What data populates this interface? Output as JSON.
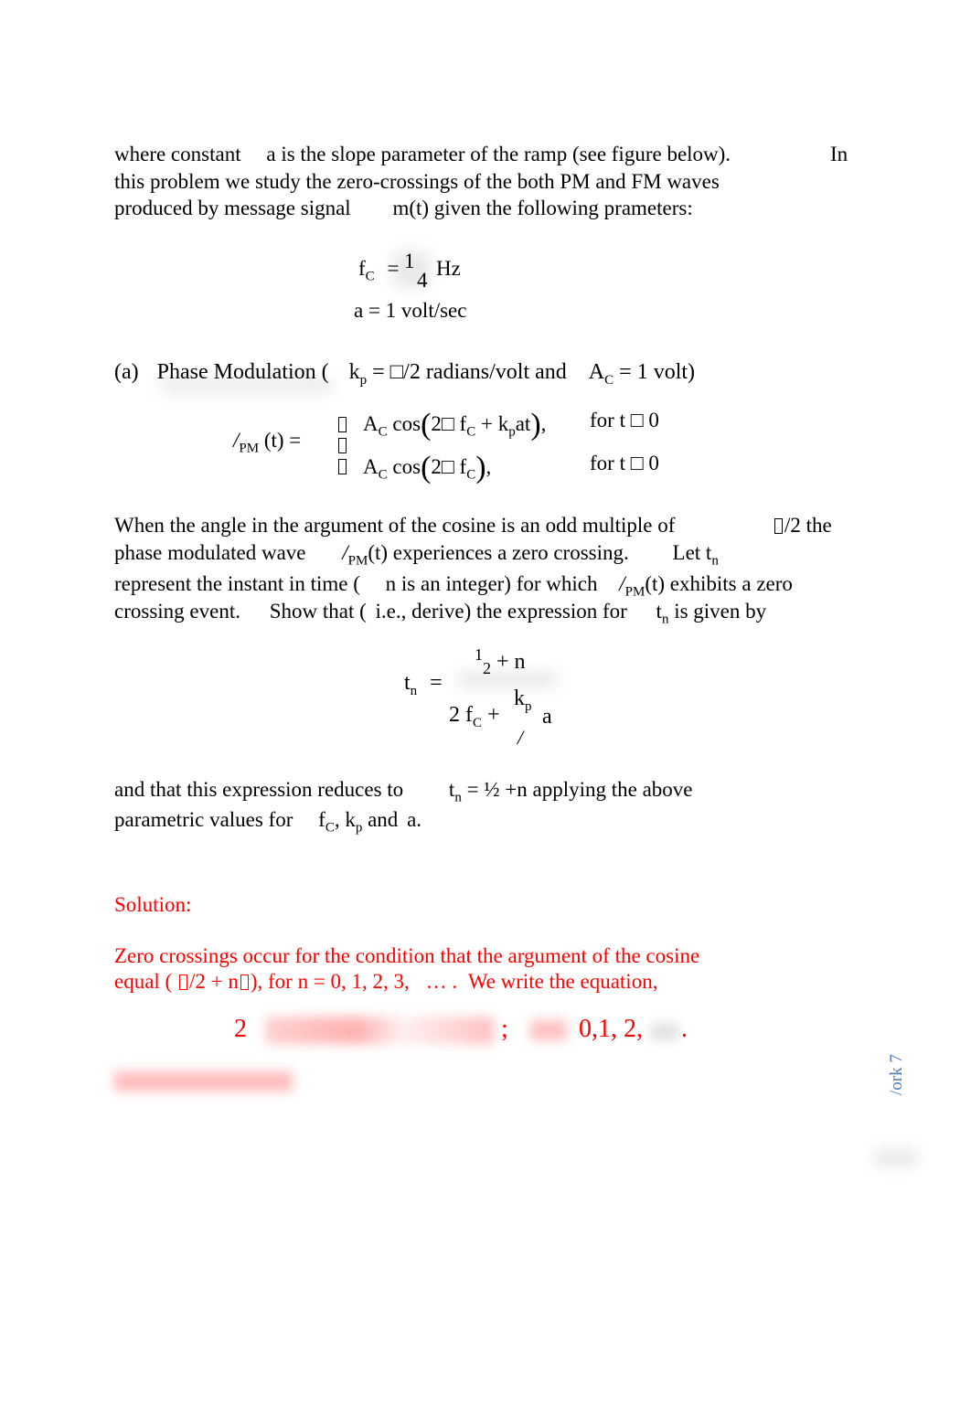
{
  "intro": {
    "line1_a": "where constant",
    "line1_b": "a",
    "line1_c": "is the slope parameter of the ramp (see figure below).",
    "line1_d": "In",
    "line2": "this problem we study the zero-crossings of the both PM and FM waves",
    "line3_a": "produced by message signal",
    "line3_b": "m(t) given the following prameters:"
  },
  "params": {
    "fc_label": "f",
    "fc_sub": "C",
    "fc_eq": "=",
    "fc_num": "1",
    "fc_den": "4",
    "fc_unit": "Hz",
    "a_line": "a = 1 volt/sec"
  },
  "part_a": {
    "label": "(a)",
    "title": "Phase Modulation (",
    "kp": "k",
    "kp_sub": "p",
    "kp_rest": "= □/2 radians/volt and",
    "ac": "A",
    "ac_sub": "C",
    "ac_rest": "= 1 volt)"
  },
  "equation_pm": {
    "lhs_sub": "PM",
    "lhs_rest": "(t) =",
    "case1": "A",
    "case1_sub": "C",
    "case1_cos": "cos",
    "case1_arg": "2□ f",
    "case1_arg_sub": "C",
    "case1_arg2": "+ k",
    "case1_arg2_sub": "p",
    "case1_arg3": "at",
    "case1_end": "),",
    "case1_cond": "for t □ 0",
    "case2_arg": "2□ f",
    "case2_end": "),",
    "case2_cond": "for t □ 0"
  },
  "body": {
    "p1_l1_a": "When the angle in the argument of the cosine is an odd multiple of",
    "p1_l1_b": "/2 the",
    "p1_l2_a": "phase modulated wave",
    "p1_l2_b": "(t) experiences a zero crossing.",
    "p1_l2_c": "Let t",
    "p1_l3_a": "represent the instant in time (",
    "p1_l3_b": "n is an integer) for which",
    "p1_l3_c": "(t) exhibits a zero",
    "p1_l4_a": "crossing event.",
    "p1_l4_b": "Show that (",
    "p1_l4_c": "i.e., derive) the expression for",
    "p1_l4_d": "t",
    "p1_l4_e": "is given by"
  },
  "tn_formula": {
    "lhs": "t",
    "lhs_sub": "n",
    "eq": "=",
    "num_1": "1",
    "num_2": "2",
    "num_rest": "+ n",
    "den_a": "2 f",
    "den_sub": "C",
    "den_plus": "+",
    "den_k": "k",
    "den_k_sub": "p",
    "den_a2": "a"
  },
  "reduce": {
    "l1_a": "and that this expression reduces to",
    "l1_b": "t",
    "l1_c": "= ½ +n applying the above",
    "l2_a": "parametric values for",
    "l2_b": "f",
    "l2_c": ", k",
    "l2_d": "and",
    "l2_e": "a."
  },
  "solution": {
    "heading": "Solution:",
    "l1": "Zero crossings occur for the condition that the argument of the cosine",
    "l2_a": "equal (",
    "l2_b": "/2 + n",
    "l2_c": "), for",
    "l2_d": "n = 0, 1, 2, 3,",
    "l2_e": "… .",
    "l2_f": "We  write the equation,",
    "eq_2": "2",
    "eq_semicolon": ";",
    "eq_vals": "0,1, 2,",
    "eq_dot": "."
  },
  "side_header": "/ork 7",
  "subscripts": {
    "n": "n",
    "C": "C",
    "PM": "PM",
    "p": "p"
  }
}
